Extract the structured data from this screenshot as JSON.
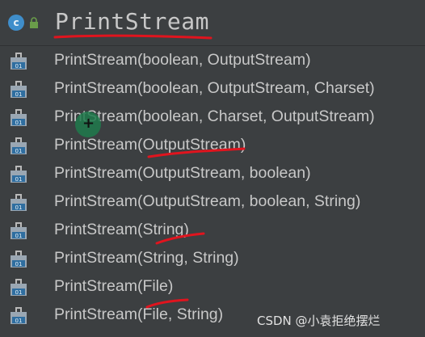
{
  "header": {
    "class_icon_letter": "c",
    "title": "PrintStream"
  },
  "constructors": [
    {
      "label": "PrintStream(boolean, OutputStream)",
      "icon": "method-locked-icon"
    },
    {
      "label": "PrintStream(boolean, OutputStream, Charset)",
      "icon": "method-locked-icon"
    },
    {
      "label": "PrintStream(boolean, Charset, OutputStream)",
      "icon": "method-locked-icon"
    },
    {
      "label": "PrintStream(OutputStream)",
      "icon": "method-locked-icon"
    },
    {
      "label": "PrintStream(OutputStream, boolean)",
      "icon": "method-locked-icon"
    },
    {
      "label": "PrintStream(OutputStream, boolean, String)",
      "icon": "method-locked-icon"
    },
    {
      "label": "PrintStream(String)",
      "icon": "method-locked-icon"
    },
    {
      "label": "PrintStream(String, String)",
      "icon": "method-locked-icon"
    },
    {
      "label": "PrintStream(File)",
      "icon": "method-locked-icon"
    },
    {
      "label": "PrintStream(File, String)",
      "icon": "method-locked-icon"
    }
  ],
  "method_icon_text": "01",
  "watermark": "CSDN @小袁拒绝摆烂",
  "colors": {
    "background": "#3c3f41",
    "text": "#c8c8c8",
    "class_icon": "#3f8ecb",
    "annotation": "#e0141e",
    "cursor": "#1e7a4c"
  }
}
